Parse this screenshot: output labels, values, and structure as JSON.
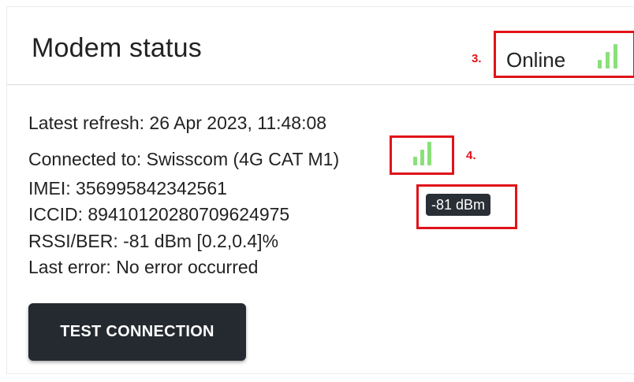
{
  "card": {
    "title": "Modem status"
  },
  "status": {
    "text": "Online",
    "signal_icon": "signal-bars-icon",
    "signal_color": "#8ae07a"
  },
  "annotations": {
    "marker_3": "3.",
    "marker_4": "4.",
    "highlight_color": "#e1131a"
  },
  "details": {
    "latest_refresh": "Latest refresh: 26 Apr 2023, 11:48:08",
    "connected_to": "Connected to:  Swisscom (4G CAT M1)",
    "imei": "IMEI: 356995842342561",
    "iccid": "ICCID: 89410120280709624975",
    "rssi_ber": "RSSI/BER: -81 dBm [0.2,0.4]%",
    "last_error": "Last error: No error occurred"
  },
  "tooltip": {
    "text": "-81 dBm"
  },
  "actions": {
    "test_connection_label": "TEST CONNECTION",
    "button_color": "#242a30"
  }
}
